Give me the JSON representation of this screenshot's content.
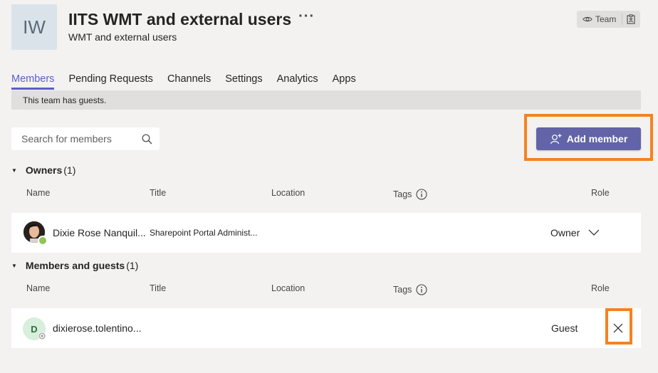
{
  "team": {
    "initials": "IW",
    "name": "IITS WMT and external users",
    "more": "···",
    "description": "WMT and external users",
    "badge_label": "Team"
  },
  "tabs": [
    {
      "label": "Members",
      "active": true
    },
    {
      "label": "Pending Requests"
    },
    {
      "label": "Channels"
    },
    {
      "label": "Settings"
    },
    {
      "label": "Analytics"
    },
    {
      "label": "Apps"
    }
  ],
  "banner": "This team has guests.",
  "search": {
    "placeholder": "Search for members",
    "value": ""
  },
  "add_member_label": "Add member",
  "columns": {
    "name": "Name",
    "title": "Title",
    "location": "Location",
    "tags": "Tags",
    "role": "Role"
  },
  "owners": {
    "heading": "Owners",
    "count": "(1)",
    "rows": [
      {
        "name": "Dixie Rose Nanquil...",
        "title": "Sharepoint Portal Administ...",
        "location": "",
        "role": "Owner",
        "presence": "available"
      }
    ]
  },
  "members": {
    "heading": "Members and guests",
    "count": "(1)",
    "rows": [
      {
        "initial": "D",
        "name": "dixierose.tolentino...",
        "title": "",
        "location": "",
        "role": "Guest",
        "presence": "offline"
      }
    ]
  },
  "colors": {
    "accent": "#6264a7",
    "highlight": "#f58220",
    "presence_available": "#92c353"
  },
  "icons": [
    "eye-icon",
    "clipboard-icon",
    "search-icon",
    "add-person-icon",
    "info-icon",
    "chevron-down-icon",
    "close-icon",
    "caret-down-icon"
  ]
}
